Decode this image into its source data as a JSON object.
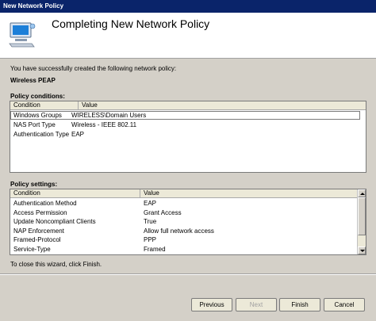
{
  "window": {
    "title": "New Network Policy"
  },
  "header": {
    "title": "Completing New Network Policy"
  },
  "intro_text": "You have successfully created the following network policy:",
  "policy_name": "Wireless PEAP",
  "conditions": {
    "label": "Policy conditions:",
    "columns": [
      "Condition",
      "Value"
    ],
    "rows": [
      [
        "Windows Groups",
        "WIRELESS\\Domain Users"
      ],
      [
        "NAS Port Type",
        "Wireless - IEEE 802.11"
      ],
      [
        "Authentication Type",
        "EAP"
      ]
    ]
  },
  "settings": {
    "label": "Policy settings:",
    "columns": [
      "Condition",
      "Value"
    ],
    "rows": [
      [
        "Authentication Method",
        "EAP"
      ],
      [
        "Access Permission",
        "Grant Access"
      ],
      [
        "Update Noncompliant Clients",
        "True"
      ],
      [
        "NAP Enforcement",
        "Allow full network access"
      ],
      [
        "Framed-Protocol",
        "PPP"
      ],
      [
        "Service-Type",
        "Framed"
      ]
    ]
  },
  "close_text": "To close this wizard, click Finish.",
  "buttons": {
    "previous": "Previous",
    "next": "Next",
    "finish": "Finish",
    "cancel": "Cancel"
  }
}
